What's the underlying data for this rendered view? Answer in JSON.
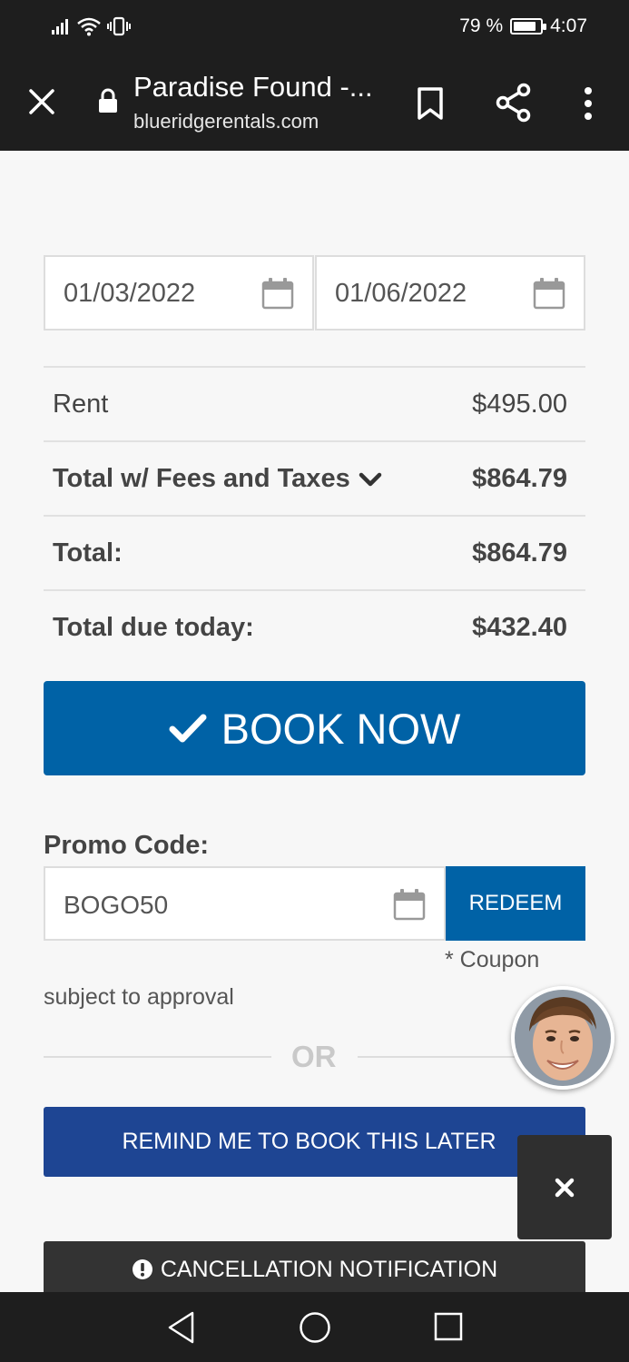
{
  "status_bar": {
    "battery_percent": "79 %",
    "time": "4:07",
    "battery_level": 0.79
  },
  "browser": {
    "page_title": "Paradise Found -...",
    "url": "blueridgerentals.com"
  },
  "booking": {
    "check_in": "01/03/2022",
    "check_out": "01/06/2022",
    "rows": [
      {
        "label": "Rent",
        "value": "$495.00"
      },
      {
        "label": "Total w/ Fees and Taxes",
        "value": "$864.79"
      },
      {
        "label": "Total:",
        "value": "$864.79"
      },
      {
        "label": "Total due today:",
        "value": "$432.40"
      }
    ],
    "book_now_label": "BOOK NOW"
  },
  "promo": {
    "label": "Promo Code:",
    "value": "BOGO50",
    "redeem_label": "REDEEM",
    "coupon_note": "* Coupon",
    "approval_note": "subject to approval"
  },
  "divider": {
    "or_label": "OR"
  },
  "remind_label": "REMIND ME TO BOOK THIS LATER",
  "cancellation_label": "CANCELLATION NOTIFICATION",
  "colors": {
    "primary_blue": "#0062a6",
    "remind_blue": "#1e4593",
    "dark_bar": "#1e1e1e"
  }
}
